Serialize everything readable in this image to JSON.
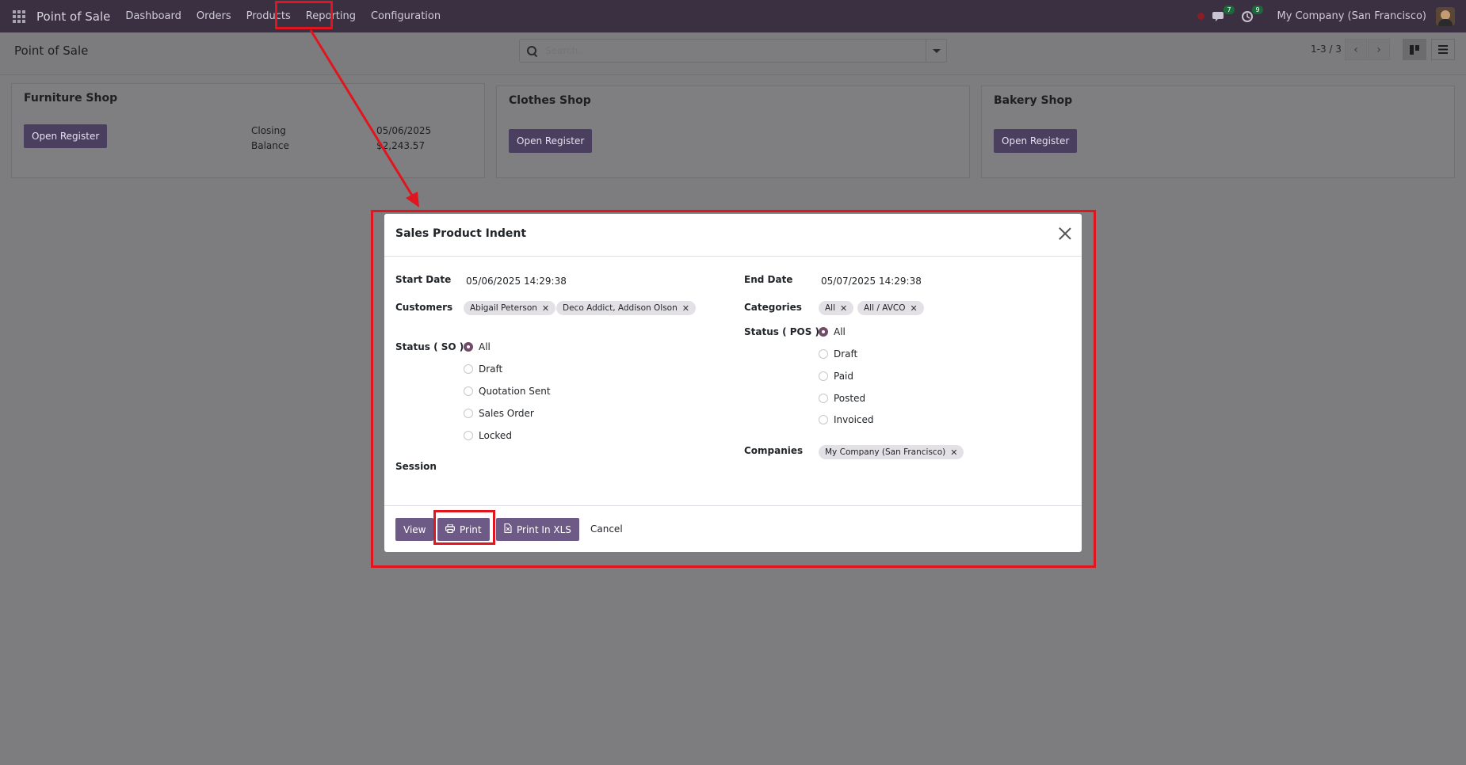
{
  "navbar": {
    "brand": "Point of Sale",
    "menu": [
      "Dashboard",
      "Orders",
      "Products",
      "Reporting",
      "Configuration"
    ],
    "messages_badge": "7",
    "activities_badge": "9",
    "company": "My Company (San Francisco)"
  },
  "control_panel": {
    "title": "Point of Sale",
    "search_placeholder": "Search...",
    "pager": "1-3 / 3"
  },
  "cards": [
    {
      "title": "Furniture Shop",
      "button": "Open Register",
      "meta_labels": [
        "Closing",
        "Balance"
      ],
      "meta_values": [
        "05/06/2025",
        "$2,243.57"
      ]
    },
    {
      "title": "Clothes Shop",
      "button": "Open Register"
    },
    {
      "title": "Bakery Shop",
      "button": "Open Register"
    }
  ],
  "modal": {
    "title": "Sales Product Indent",
    "start_date_label": "Start Date",
    "start_date": "05/06/2025 14:29:38",
    "end_date_label": "End Date",
    "end_date": "05/07/2025 14:29:38",
    "customers_label": "Customers",
    "customers": [
      "Abigail Peterson",
      "Deco Addict, Addison Olson"
    ],
    "categories_label": "Categories",
    "categories": [
      "All",
      "All / AVCO"
    ],
    "status_so_label": "Status ( SO )",
    "status_so_options": [
      "All",
      "Draft",
      "Quotation Sent",
      "Sales Order",
      "Locked"
    ],
    "status_pos_label": "Status ( POS )",
    "status_pos_options": [
      "All",
      "Draft",
      "Paid",
      "Posted",
      "Invoiced"
    ],
    "session_label": "Session",
    "companies_label": "Companies",
    "companies": [
      "My Company (San Francisco)"
    ],
    "buttons": {
      "view": "View",
      "print": "Print",
      "print_xls": "Print In XLS",
      "cancel": "Cancel"
    }
  },
  "colors": {
    "navbar": "#3a3042",
    "primary_button": "#6e5a87",
    "annotation": "#e0151d"
  }
}
